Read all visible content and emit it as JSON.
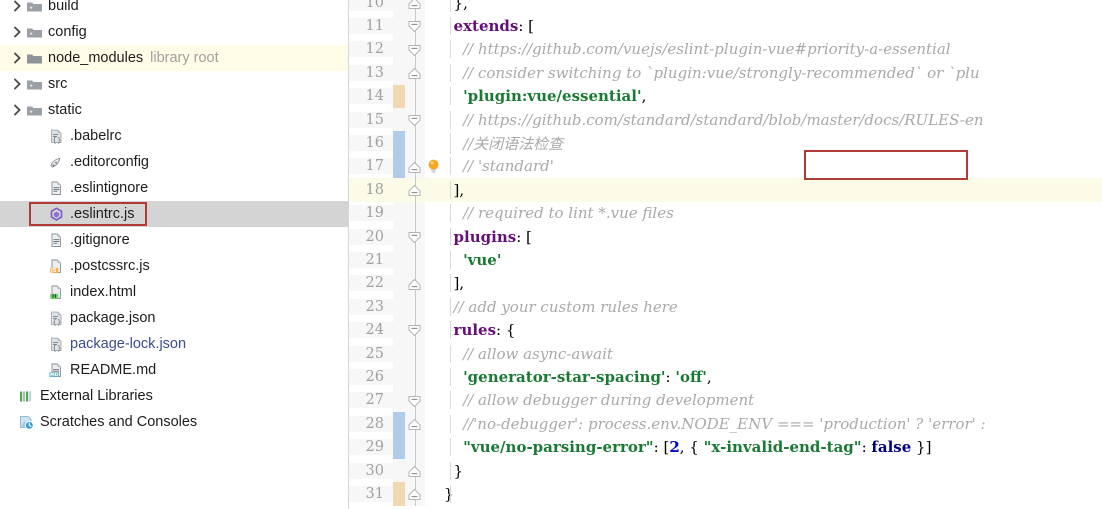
{
  "project_tree": {
    "name": "project-tool-window",
    "items": [
      {
        "label": "build",
        "type": "folder",
        "icon": "folder-icon",
        "indent": 1,
        "expandable": true,
        "state": "collapsed",
        "highlight": "none"
      },
      {
        "label": "config",
        "type": "folder",
        "icon": "folder-icon",
        "indent": 1,
        "expandable": true,
        "state": "collapsed",
        "highlight": "none"
      },
      {
        "label": "node_modules",
        "sublabel": "library root",
        "type": "folder",
        "icon": "folder-library-icon",
        "indent": 1,
        "expandable": true,
        "state": "collapsed",
        "highlight": "yellow"
      },
      {
        "label": "src",
        "type": "folder",
        "icon": "folder-icon",
        "indent": 1,
        "expandable": true,
        "state": "collapsed",
        "highlight": "none"
      },
      {
        "label": "static",
        "type": "folder",
        "icon": "folder-icon",
        "indent": 1,
        "expandable": true,
        "state": "collapsed",
        "highlight": "none"
      },
      {
        "label": ".babelrc",
        "type": "file",
        "icon": "json-file-icon",
        "indent": 2,
        "expandable": false,
        "highlight": "none"
      },
      {
        "label": ".editorconfig",
        "type": "file",
        "icon": "editorconfig-file-icon",
        "indent": 2,
        "expandable": false,
        "highlight": "none"
      },
      {
        "label": ".eslintignore",
        "type": "file",
        "icon": "text-file-icon",
        "indent": 2,
        "expandable": false,
        "highlight": "none"
      },
      {
        "label": ".eslintrc.js",
        "type": "file",
        "icon": "eslint-file-icon",
        "indent": 2,
        "expandable": false,
        "highlight": "selected",
        "annotated": true
      },
      {
        "label": ".gitignore",
        "type": "file",
        "icon": "text-file-icon",
        "indent": 2,
        "expandable": false,
        "highlight": "none"
      },
      {
        "label": ".postcssrc.js",
        "type": "file",
        "icon": "js-file-icon",
        "indent": 2,
        "expandable": false,
        "highlight": "none"
      },
      {
        "label": "index.html",
        "type": "file",
        "icon": "html-file-icon",
        "indent": 2,
        "expandable": false,
        "highlight": "none"
      },
      {
        "label": "package.json",
        "type": "file",
        "icon": "json-file-icon",
        "indent": 2,
        "expandable": false,
        "highlight": "none"
      },
      {
        "label": "package-lock.json",
        "type": "file",
        "icon": "json-file-icon",
        "indent": 2,
        "expandable": false,
        "highlight": "none",
        "label_color": "blue"
      },
      {
        "label": "README.md",
        "type": "file",
        "icon": "markdown-file-icon",
        "indent": 2,
        "expandable": false,
        "highlight": "none"
      },
      {
        "label": "External Libraries",
        "type": "node",
        "icon": "external-libraries-icon",
        "indent": 0,
        "expandable": false,
        "highlight": "none"
      },
      {
        "label": "Scratches and Consoles",
        "type": "node",
        "icon": "scratches-icon",
        "indent": 0,
        "expandable": false,
        "highlight": "none"
      }
    ]
  },
  "editor": {
    "name": "eslintrc-js-editor",
    "current_line": 18,
    "annotation_box_line": 17,
    "lines": [
      {
        "num": 10,
        "fold": "end",
        "change": "none",
        "bulb": false,
        "tokens": [
          {
            "t": "  ",
            "c": "t-plain"
          },
          {
            "t": "},",
            "c": "t-punc"
          }
        ]
      },
      {
        "num": 11,
        "fold": "start",
        "change": "none",
        "bulb": false,
        "tokens": [
          {
            "t": "  ",
            "c": "t-plain"
          },
          {
            "t": "extends",
            "c": "t-kw"
          },
          {
            "t": ": [",
            "c": "t-punc"
          }
        ]
      },
      {
        "num": 12,
        "fold": "start",
        "change": "none",
        "bulb": false,
        "tokens": [
          {
            "t": "    // https://github.com/vuejs/eslint-plugin-vue#priority-a-essential",
            "c": "t-com"
          }
        ]
      },
      {
        "num": 13,
        "fold": "end",
        "change": "none",
        "bulb": false,
        "tokens": [
          {
            "t": "    // consider switching to `plugin:vue/strongly-recommended` or `plu",
            "c": "t-com"
          }
        ]
      },
      {
        "num": 14,
        "fold": "none",
        "change": "tan",
        "bulb": false,
        "tokens": [
          {
            "t": "    ",
            "c": "t-plain"
          },
          {
            "t": "'plugin:vue/essential'",
            "c": "t-str"
          },
          {
            "t": ",",
            "c": "t-punc"
          }
        ]
      },
      {
        "num": 15,
        "fold": "start",
        "change": "none",
        "bulb": false,
        "tokens": [
          {
            "t": "    // https://github.com/standard/standard/blob/master/docs/RULES-en",
            "c": "t-com"
          }
        ]
      },
      {
        "num": 16,
        "fold": "none",
        "change": "blue",
        "bulb": false,
        "tokens": [
          {
            "t": "    //关闭语法检查",
            "c": "t-com"
          }
        ]
      },
      {
        "num": 17,
        "fold": "end",
        "change": "blue",
        "bulb": true,
        "tokens": [
          {
            "t": "    // 'standard'",
            "c": "t-com"
          }
        ]
      },
      {
        "num": 18,
        "fold": "end",
        "change": "none",
        "bulb": false,
        "current": true,
        "tokens": [
          {
            "t": "  ",
            "c": "t-plain"
          },
          {
            "t": "],",
            "c": "t-punc"
          }
        ]
      },
      {
        "num": 19,
        "fold": "none",
        "change": "none",
        "bulb": false,
        "tokens": [
          {
            "t": "    // required to lint *.vue files",
            "c": "t-com"
          }
        ]
      },
      {
        "num": 20,
        "fold": "start",
        "change": "none",
        "bulb": false,
        "tokens": [
          {
            "t": "  ",
            "c": "t-plain"
          },
          {
            "t": "plugins",
            "c": "t-kw"
          },
          {
            "t": ": [",
            "c": "t-punc"
          }
        ]
      },
      {
        "num": 21,
        "fold": "none",
        "change": "none",
        "bulb": false,
        "tokens": [
          {
            "t": "    ",
            "c": "t-plain"
          },
          {
            "t": "'vue'",
            "c": "t-str"
          }
        ]
      },
      {
        "num": 22,
        "fold": "end",
        "change": "none",
        "bulb": false,
        "tokens": [
          {
            "t": "  ",
            "c": "t-plain"
          },
          {
            "t": "],",
            "c": "t-punc"
          }
        ]
      },
      {
        "num": 23,
        "fold": "none",
        "change": "none",
        "bulb": false,
        "tokens": [
          {
            "t": "  // add your custom rules here",
            "c": "t-com"
          }
        ]
      },
      {
        "num": 24,
        "fold": "start",
        "change": "none",
        "bulb": false,
        "tokens": [
          {
            "t": "  ",
            "c": "t-plain"
          },
          {
            "t": "rules",
            "c": "t-kw"
          },
          {
            "t": ": {",
            "c": "t-punc"
          }
        ]
      },
      {
        "num": 25,
        "fold": "none",
        "change": "none",
        "bulb": false,
        "tokens": [
          {
            "t": "    // allow async-await",
            "c": "t-com"
          }
        ]
      },
      {
        "num": 26,
        "fold": "none",
        "change": "none",
        "bulb": false,
        "tokens": [
          {
            "t": "    ",
            "c": "t-plain"
          },
          {
            "t": "'generator-star-spacing'",
            "c": "t-str"
          },
          {
            "t": ": ",
            "c": "t-punc"
          },
          {
            "t": "'off'",
            "c": "t-str"
          },
          {
            "t": ",",
            "c": "t-punc"
          }
        ]
      },
      {
        "num": 27,
        "fold": "start",
        "change": "none",
        "bulb": false,
        "tokens": [
          {
            "t": "    // allow debugger during development",
            "c": "t-com"
          }
        ]
      },
      {
        "num": 28,
        "fold": "end",
        "change": "blue",
        "bulb": false,
        "tokens": [
          {
            "t": "    //'no-debugger': process.env.NODE_ENV === 'production' ? 'error' :",
            "c": "t-com"
          }
        ]
      },
      {
        "num": 29,
        "fold": "none",
        "change": "blue",
        "bulb": false,
        "tokens": [
          {
            "t": "    ",
            "c": "t-plain"
          },
          {
            "t": "\"vue/no-parsing-error\"",
            "c": "t-str"
          },
          {
            "t": ": [",
            "c": "t-punc"
          },
          {
            "t": "2",
            "c": "t-num"
          },
          {
            "t": ", { ",
            "c": "t-punc"
          },
          {
            "t": "\"x-invalid-end-tag\"",
            "c": "t-str"
          },
          {
            "t": ": ",
            "c": "t-punc"
          },
          {
            "t": "false",
            "c": "t-bool"
          },
          {
            "t": " }]",
            "c": "t-punc"
          }
        ]
      },
      {
        "num": 30,
        "fold": "end",
        "change": "none",
        "bulb": false,
        "tokens": [
          {
            "t": "  ",
            "c": "t-plain"
          },
          {
            "t": "}",
            "c": "t-punc"
          }
        ]
      },
      {
        "num": 31,
        "fold": "end",
        "change": "tan",
        "bulb": false,
        "tokens": [
          {
            "t": "}",
            "c": "t-punc"
          }
        ]
      }
    ]
  },
  "colors": {
    "selection_bg": "#d4d4d4",
    "annotation_border": "#b03a34",
    "current_line_bg": "#fcfbe8",
    "library_root_bg": "#fffde7",
    "change_added": "#f0d9b0",
    "change_modified": "#b0ccea",
    "keyword": "#660e7a",
    "string": "#1a7a33",
    "comment": "#a9a9a9",
    "number": "#0000d0"
  }
}
